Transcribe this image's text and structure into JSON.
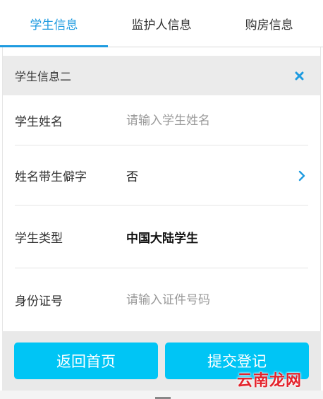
{
  "tabs": [
    {
      "label": "学生信息",
      "active": true
    },
    {
      "label": "监护人信息",
      "active": false
    },
    {
      "label": "购房信息",
      "active": false
    }
  ],
  "panel": {
    "title": "学生信息二",
    "close_icon": "close-x-icon"
  },
  "fields": {
    "student_name": {
      "label": "学生姓名",
      "placeholder": "请输入学生姓名",
      "value": ""
    },
    "rare_char": {
      "label": "姓名带生僻字",
      "value": "否",
      "icon": "chevron-right-icon"
    },
    "student_type": {
      "label": "学生类型",
      "value": "中国大陆学生"
    },
    "id_number": {
      "label": "身份证号",
      "placeholder": "请输入证件号码",
      "value": ""
    }
  },
  "buttons": {
    "back": "返回首页",
    "submit": "提交登记"
  },
  "watermark": "云南龙网",
  "colors": {
    "accent": "#1e9be0",
    "button": "#00c5f5",
    "watermark": "#e4232c"
  }
}
